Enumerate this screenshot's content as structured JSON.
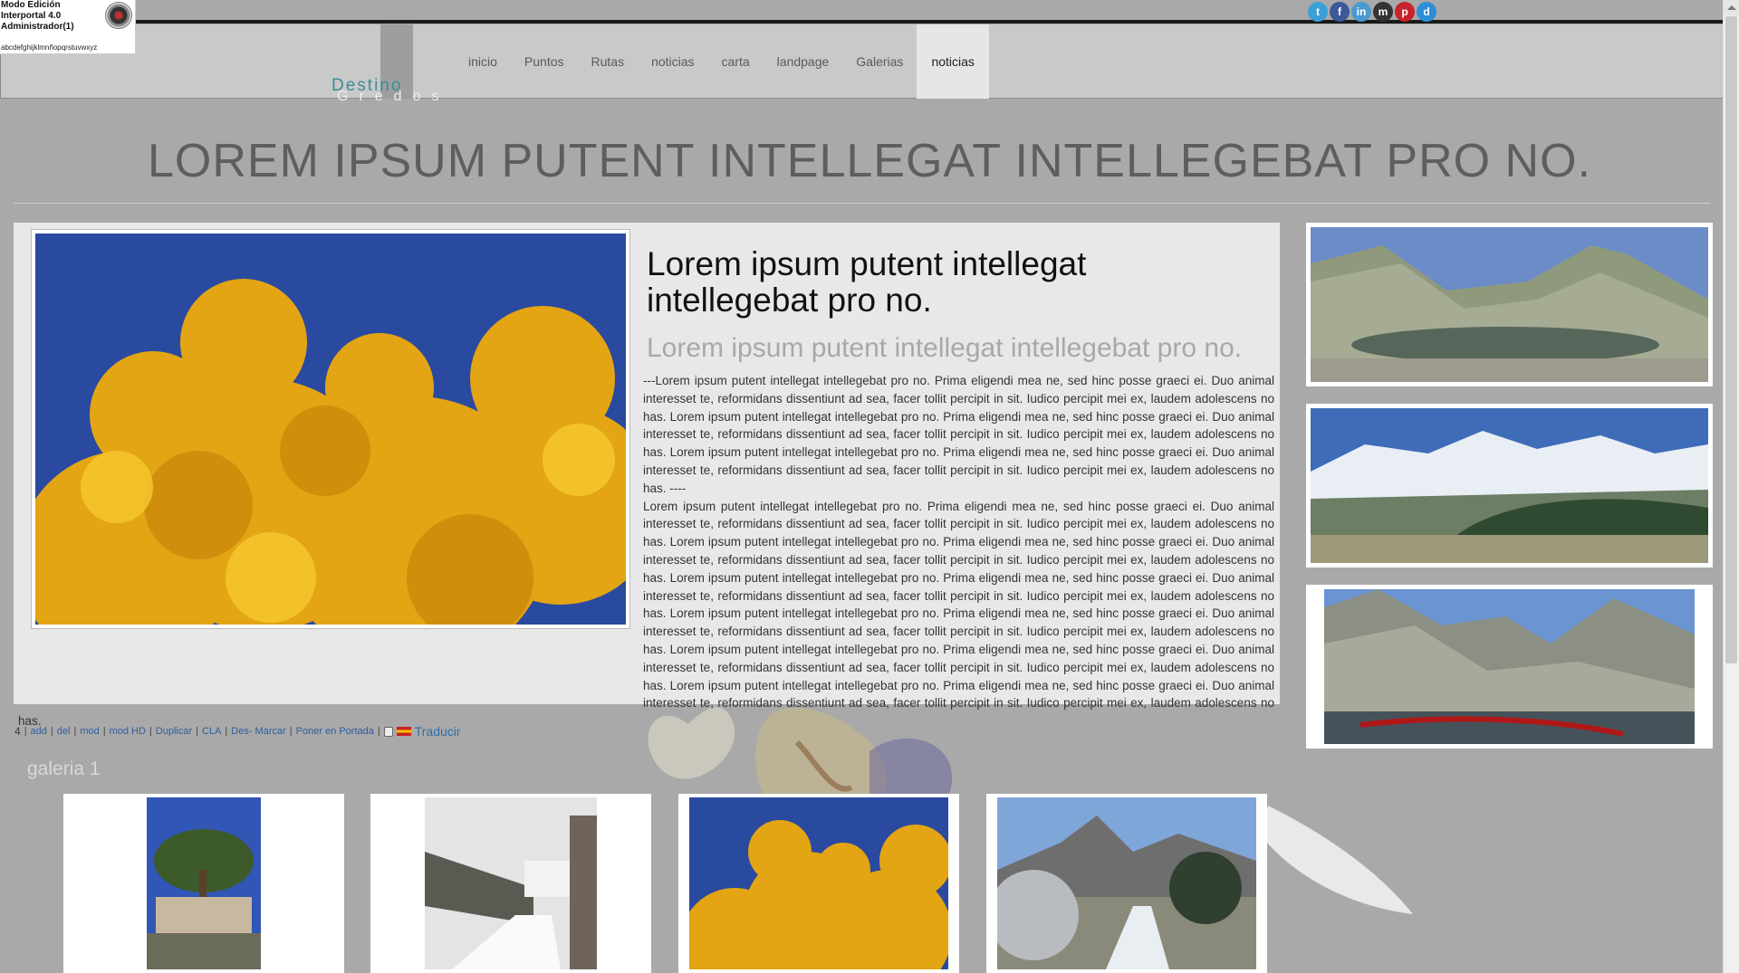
{
  "admin": {
    "line1": "Modo Edición",
    "line2": "Interportal 4.0",
    "line3": "Administrador(1)",
    "alphabet": "abcdefghijklmnñopqrstuvwxyz"
  },
  "logo": {
    "word1": "Destino",
    "word2": "Gredos"
  },
  "nav": [
    "inicio",
    "Puntos",
    "Rutas",
    "noticias",
    "carta",
    "landpage",
    "Galerias",
    "noticias"
  ],
  "social": [
    "twitter-icon",
    "facebook-icon",
    "linkedin-icon",
    "myspace-icon",
    "pinterest-icon",
    "delicious-icon"
  ],
  "page_title": "LOREM IPSUM PUTENT INTELLEGAT INTELLEGEBAT PRO NO.",
  "article": {
    "title": "Lorem ipsum putent intellegat intellegebat pro no.",
    "subtitle": "Lorem ipsum putent intellegat intellegebat pro no.",
    "para1": "---Lorem ipsum putent intellegat intellegebat pro no. Prima eligendi mea ne, sed hinc posse graeci ei. Duo animal interesset te, reformidans dissentiunt ad sea, facer tollit percipit in sit. Iudico percipit mei ex, laudem adolescens no has. Lorem ipsum putent intellegat intellegebat pro no. Prima eligendi mea ne, sed hinc posse graeci ei. Duo animal interesset te, reformidans dissentiunt ad sea, facer tollit percipit in sit. Iudico percipit mei ex, laudem adolescens no has. Lorem ipsum putent intellegat intellegebat pro no. Prima eligendi mea ne, sed hinc posse graeci ei. Duo animal interesset te, reformidans dissentiunt ad sea, facer tollit percipit in sit. Iudico percipit mei ex, laudem adolescens no has. ----",
    "para2": "Lorem ipsum putent intellegat intellegebat pro no. Prima eligendi mea ne, sed hinc posse graeci ei. Duo animal interesset te, reformidans dissentiunt ad sea, facer tollit percipit in sit. Iudico percipit mei ex, laudem adolescens no has. Lorem ipsum putent intellegat intellegebat pro no. Prima eligendi mea ne, sed hinc posse graeci ei. Duo animal interesset te, reformidans dissentiunt ad sea, facer tollit percipit in sit. Iudico percipit mei ex, laudem adolescens no has. Lorem ipsum putent intellegat intellegebat pro no. Prima eligendi mea ne, sed hinc posse graeci ei. Duo animal interesset te, reformidans dissentiunt ad sea, facer tollit percipit in sit. Iudico percipit mei ex, laudem adolescens no has. Lorem ipsum putent intellegat intellegebat pro no. Prima eligendi mea ne, sed hinc posse graeci ei. Duo animal interesset te, reformidans dissentiunt ad sea, facer tollit percipit in sit. Iudico percipit mei ex, laudem adolescens no has. Lorem ipsum putent intellegat intellegebat pro no. Prima eligendi mea ne, sed hinc posse graeci ei. Duo animal interesset te, reformidans dissentiunt ad sea, facer tollit percipit in sit. Iudico percipit mei ex, laudem adolescens no has. Lorem ipsum putent intellegat intellegebat pro no. Prima eligendi mea ne, sed hinc posse graeci ei. Duo animal interesset te, reformidans dissentiunt ad sea, facer tollit percipit in sit. Iudico percipit mei ex, laudem adolescens no has."
  },
  "toolbar": {
    "count": "4",
    "add": "add",
    "del": "del",
    "mod": "mod",
    "mod_hd": "mod HD",
    "duplicar": "Duplicar",
    "cla": "CLA",
    "desmarcar": "Des- Marcar",
    "portada": "Poner en Portada",
    "traducir": "Traducir"
  },
  "gallery": {
    "label": "galeria 1"
  },
  "colors": {
    "background": "#a9a9a9",
    "header": "#c9c9c9",
    "logo_accent": "#3a8e98",
    "link": "#2e5e9e"
  }
}
